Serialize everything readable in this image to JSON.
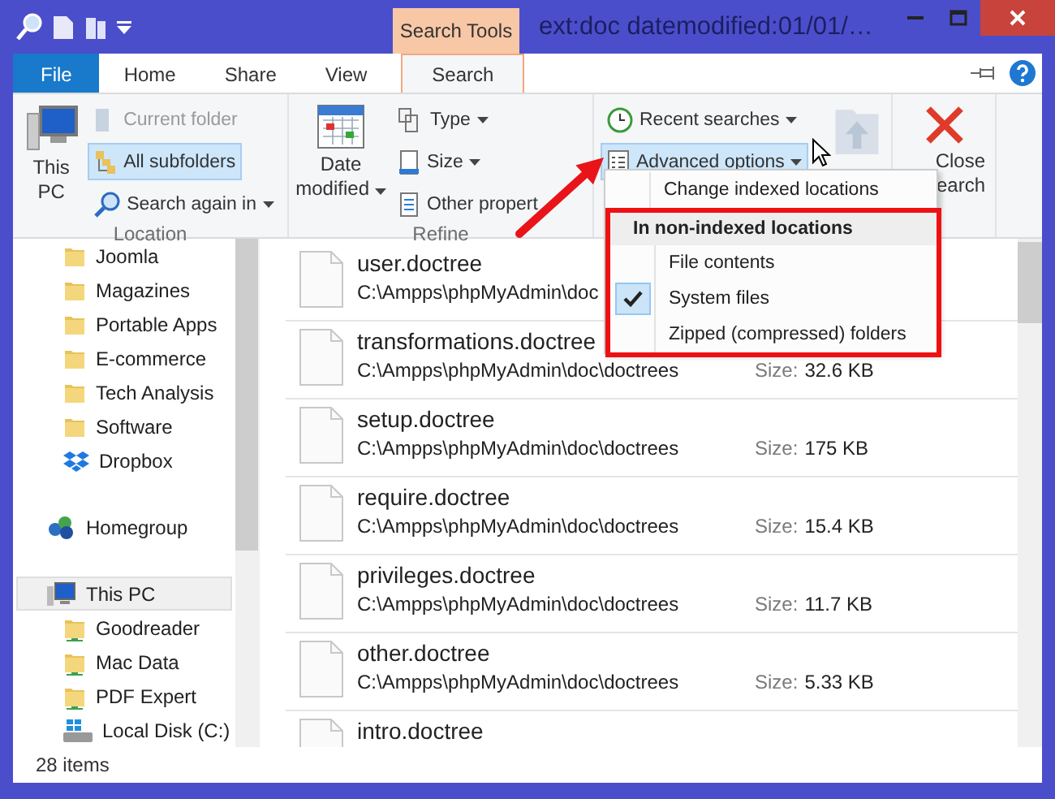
{
  "window": {
    "title": "ext:doc datemodified:01/01/…",
    "context_tab": "Search Tools"
  },
  "tabs": [
    {
      "label": "File",
      "kind": "file",
      "selected": false
    },
    {
      "label": "Home",
      "kind": "tab",
      "selected": false
    },
    {
      "label": "Share",
      "kind": "tab",
      "selected": false
    },
    {
      "label": "View",
      "kind": "tab",
      "selected": false
    },
    {
      "label": "Search",
      "kind": "tab",
      "selected": true
    }
  ],
  "ribbon": {
    "location": {
      "label": "Location",
      "this_pc": "This PC",
      "current_folder": {
        "label": "Current folder",
        "disabled": true,
        "selected": false
      },
      "all_subfolders": {
        "label": "All subfolders",
        "disabled": false,
        "selected": true
      },
      "search_again": "Search again in"
    },
    "refine": {
      "label": "Refine",
      "date_modified": "Date modified",
      "type": "Type",
      "size": "Size",
      "other": "Other propert"
    },
    "options": {
      "recent": "Recent searches",
      "advanced": {
        "label": "Advanced options",
        "pressed": true
      }
    },
    "close": {
      "lines": [
        "Close",
        "earch"
      ]
    }
  },
  "nav": {
    "favorites": [
      {
        "label": "Joomla",
        "kind": "folder",
        "selected": false
      },
      {
        "label": "Magazines",
        "kind": "folder",
        "selected": false
      },
      {
        "label": "Portable Apps",
        "kind": "folder",
        "selected": false
      },
      {
        "label": "E-commerce",
        "kind": "folder",
        "selected": false
      },
      {
        "label": "Tech Analysis",
        "kind": "folder",
        "selected": false
      },
      {
        "label": "Software",
        "kind": "folder",
        "selected": false
      },
      {
        "label": "Dropbox",
        "kind": "dropbox",
        "selected": false
      }
    ],
    "roots": [
      {
        "label": "Homegroup",
        "kind": "homegroup",
        "selected": false
      },
      {
        "label": "This PC",
        "kind": "pc",
        "selected": true,
        "children": [
          {
            "label": "Goodreader",
            "kind": "netfolder",
            "selected": false
          },
          {
            "label": "Mac Data",
            "kind": "netfolder",
            "selected": false
          },
          {
            "label": "PDF Expert",
            "kind": "netfolder",
            "selected": false
          },
          {
            "label": "Local Disk (C:)",
            "kind": "disk",
            "selected": false
          }
        ]
      }
    ]
  },
  "files": [
    {
      "name": "user.doctree",
      "path": "C:\\Ampps\\phpMyAdmin\\doc"
    },
    {
      "name": "transformations.doctree",
      "path": "C:\\Ampps\\phpMyAdmin\\doc\\doctrees",
      "size_label": "Size:",
      "size": "32.6 KB"
    },
    {
      "name": "setup.doctree",
      "path": "C:\\Ampps\\phpMyAdmin\\doc\\doctrees",
      "size_label": "Size:",
      "size": "175 KB"
    },
    {
      "name": "require.doctree",
      "path": "C:\\Ampps\\phpMyAdmin\\doc\\doctrees",
      "size_label": "Size:",
      "size": "15.4 KB"
    },
    {
      "name": "privileges.doctree",
      "path": "C:\\Ampps\\phpMyAdmin\\doc\\doctrees",
      "size_label": "Size:",
      "size": "11.7 KB"
    },
    {
      "name": "other.doctree",
      "path": "C:\\Ampps\\phpMyAdmin\\doc\\doctrees",
      "size_label": "Size:",
      "size": "5.33 KB"
    },
    {
      "name": "intro.doctree"
    }
  ],
  "menu": {
    "items": [
      {
        "kind": "item",
        "label": "Change indexed locations"
      },
      {
        "kind": "header",
        "label": "In non-indexed locations"
      },
      {
        "kind": "option",
        "label": "File contents",
        "checked": false
      },
      {
        "kind": "option",
        "label": "System files",
        "checked": true
      },
      {
        "kind": "option",
        "label": "Zipped (compressed) folders",
        "checked": false
      }
    ]
  },
  "status_bar": {
    "count": "28 items"
  }
}
